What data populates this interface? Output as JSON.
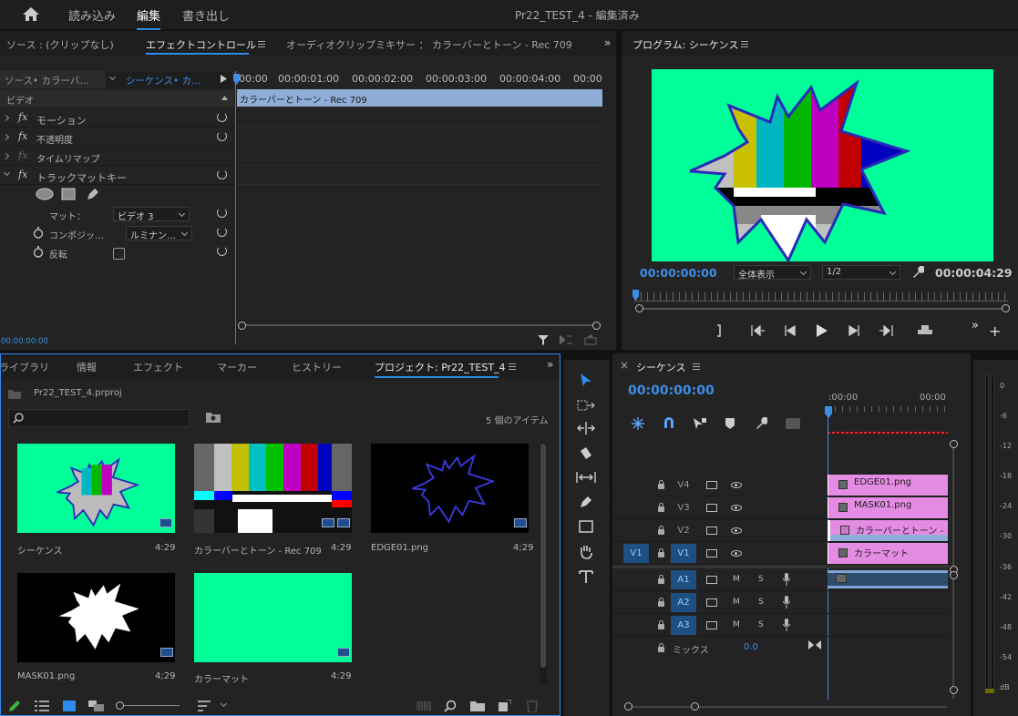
{
  "topbar": {
    "import": "読み込み",
    "edit": "編集",
    "export": "書き出し",
    "title": "Pr22_TEST_4 - 編集済み"
  },
  "source_panel": {
    "tabs": [
      "ソース : (クリップなし)",
      "エフェクトコントロール",
      "オーディオクリップミキサー ： カラーバーとトーン - Rec 709"
    ],
    "source_label": "ソース• カラーバ…",
    "sequence_label": "シーケンス• カ…",
    "ruler": [
      "00:00",
      "00:00:01:00",
      "00:00:02:00",
      "00:00:03:00",
      "00:00:04:00",
      "00:00"
    ],
    "clip_name": "カラーバーとトーン - Rec 709",
    "section": "ビデオ",
    "effects": [
      "モーション",
      "不透明度",
      "タイムリマップ",
      "トラックマットキー"
    ],
    "matte_label": "マット：",
    "matte_value": "ビデオ 3",
    "composite_label": "コンポジッ…",
    "composite_value": "ルミナン…",
    "reverse_label": "反転",
    "timecode": "00:00:00:00"
  },
  "program_panel": {
    "title": "プログラム: シーケンス",
    "timecode": "00:00:00:00",
    "zoom": "全体表示",
    "resolution": "1/2",
    "duration": "00:00:04:29",
    "bg_color": "#00ff99"
  },
  "project_panel": {
    "tabs": [
      "ライブラリ",
      "情報",
      "エフェクト",
      "マーカー",
      "ヒストリー",
      "プロジェクト: Pr22_TEST_4"
    ],
    "file": "Pr22_TEST_4.prproj",
    "count": "5 個のアイテム",
    "items": [
      {
        "name": "シーケンス",
        "duration": "4:29"
      },
      {
        "name": "カラーバーとトーン - Rec 709",
        "duration": "4:29"
      },
      {
        "name": "EDGE01.png",
        "duration": "4;29"
      },
      {
        "name": "MASK01.png",
        "duration": "4;29"
      },
      {
        "name": "カラーマット",
        "duration": "4:29"
      }
    ]
  },
  "timeline": {
    "title": "シーケンス",
    "timecode": "00:00:00:00",
    "ruler": [
      ":00:00",
      "00:00"
    ],
    "video_tracks": [
      {
        "label": "V4",
        "clip": "EDGE01.png"
      },
      {
        "label": "V3",
        "clip": "MASK01.png"
      },
      {
        "label": "V2",
        "clip": "カラーバーとトーン -"
      },
      {
        "label": "V1",
        "clip": "カラーマット",
        "source": "V1"
      }
    ],
    "audio_tracks": [
      "A1",
      "A2",
      "A3"
    ],
    "mute": "M",
    "solo": "S",
    "mix_label": "ミックス",
    "mix_value": "0.0"
  },
  "meter": {
    "labels": [
      "0",
      "-6",
      "-12",
      "-18",
      "-24",
      "-30",
      "-36",
      "-42",
      "-48",
      "-54",
      "dB"
    ]
  }
}
